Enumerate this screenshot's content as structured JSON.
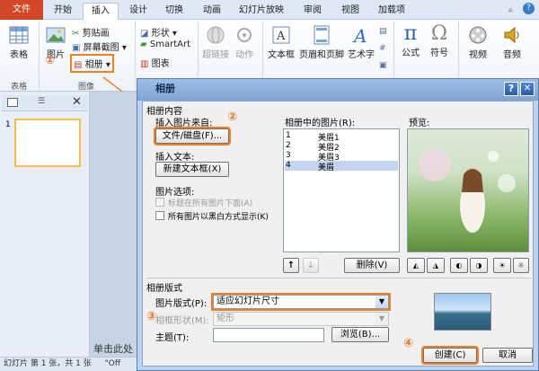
{
  "tabs": [
    "文件",
    "开始",
    "插入",
    "设计",
    "切换",
    "动画",
    "幻灯片放映",
    "审阅",
    "视图",
    "加载项"
  ],
  "ribbon": {
    "table": "表格",
    "table_group": "表格",
    "picture": "图片",
    "clipart": "剪贴画",
    "screenshot": "屏幕截图",
    "album": "相册",
    "image_group": "图像",
    "shapes": "形状",
    "smartart": "SmartArt",
    "chart": "图表",
    "hyperlink": "超链接",
    "action": "动作",
    "textbox": "文本框",
    "header_footer": "页眉和页脚",
    "wordart": "艺术字",
    "formula": "公式",
    "symbol": "符号",
    "video": "视频",
    "audio": "音频",
    "step1": "①"
  },
  "slide_num": "1",
  "status": "幻灯片 第 1 张，共 1 张",
  "status2": "\"Off",
  "slide_edit_text": "单击此处",
  "dialog": {
    "title": "相册",
    "help": "?",
    "close": "✕",
    "album_content": "相册内容",
    "insert_from": "插入图片来自:",
    "file_btn": "文件/磁盘(F)...",
    "step2": "②",
    "insert_text": "插入文本:",
    "new_textbox_btn": "新建文本框(X)",
    "pic_options": "图片选项:",
    "opt_captions": "标题在所有图片下面(A)",
    "opt_bw": "所有图片以黑白方式显示(K)",
    "pics_in_album": "相册中的图片(R):",
    "items": [
      {
        "n": "1",
        "name": "美眉1"
      },
      {
        "n": "2",
        "name": "美眉2"
      },
      {
        "n": "3",
        "name": "美眉3"
      },
      {
        "n": "4",
        "name": "美眉"
      }
    ],
    "preview": "预览:",
    "up": "↑",
    "down": "↓",
    "remove_btn": "删除(V)",
    "album_layout": "相册版式",
    "pic_layout_label": "图片版式(P):",
    "pic_layout_value": "适应幻灯片尺寸",
    "frame_label": "相框形状(M):",
    "frame_value": "矩形",
    "step3": "③",
    "theme_label": "主题(T):",
    "theme_value": "",
    "browse_btn": "浏览(B)...",
    "step4": "④",
    "create_btn": "创建(C)",
    "cancel_btn": "取消"
  },
  "colors": {
    "accent": "#f08020",
    "file_tab": "#d24726",
    "selection": "#c3d5f0"
  }
}
